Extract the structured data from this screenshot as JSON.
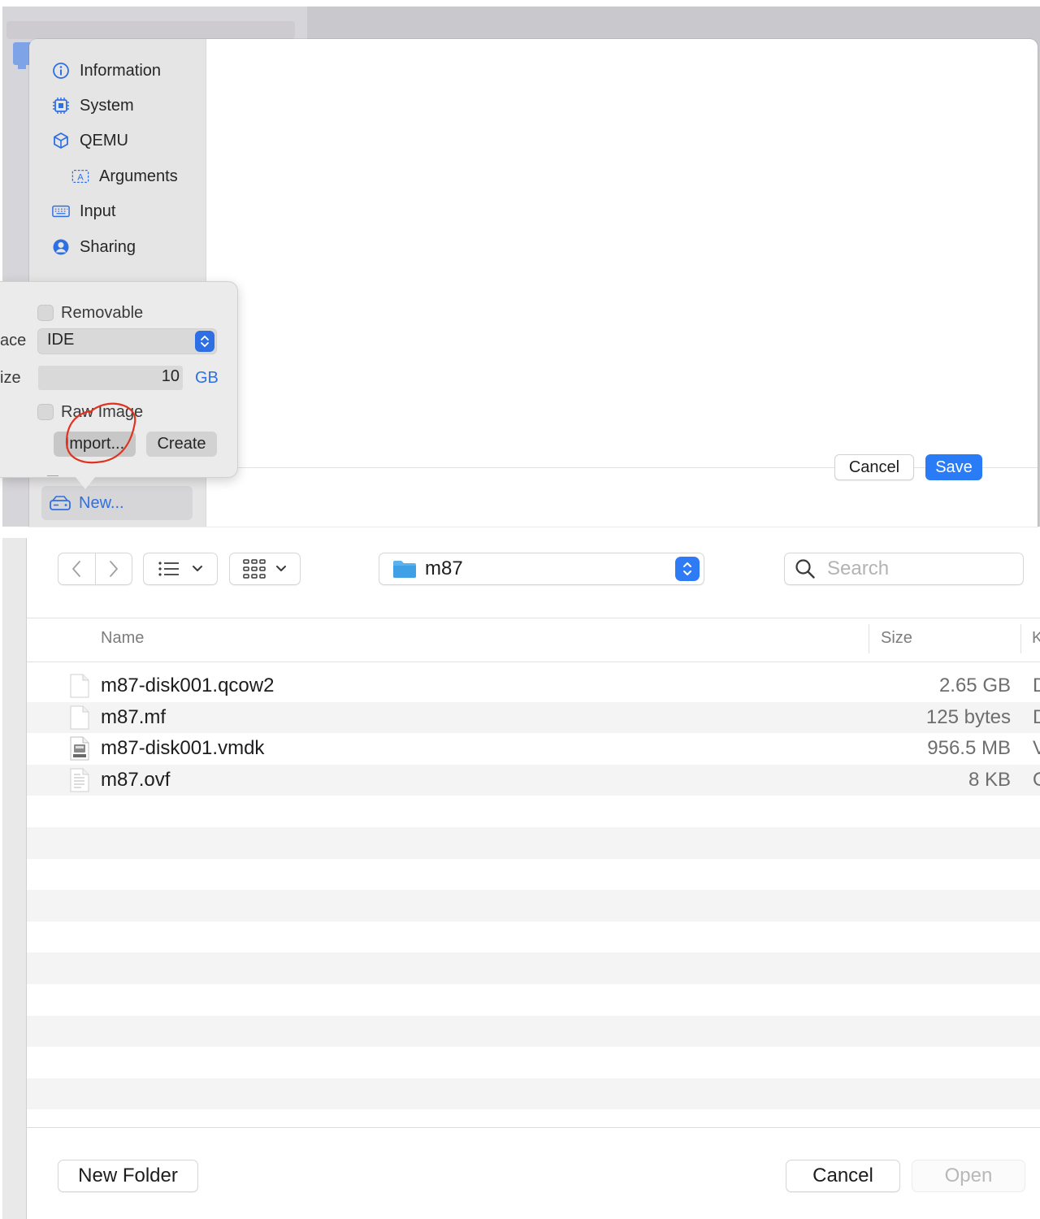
{
  "top": {
    "sidebar": {
      "items": [
        {
          "label": "Information",
          "icon": "info-circle-icon"
        },
        {
          "label": "System",
          "icon": "cpu-chip-icon"
        },
        {
          "label": "QEMU",
          "icon": "cube-icon"
        },
        {
          "label": "Arguments",
          "icon": "arguments-a-icon"
        },
        {
          "label": "Input",
          "icon": "keyboard-icon"
        },
        {
          "label": "Sharing",
          "icon": "person-circle-icon"
        }
      ],
      "new_button": "New..."
    },
    "popover": {
      "removable_label": "Removable",
      "removable_checked": false,
      "interface_label_partial": "ace",
      "interface_value": "IDE",
      "size_label_partial": "ize",
      "size_value": "10",
      "size_unit": "GB",
      "raw_image_label": "Raw Image",
      "raw_image_checked": false,
      "import_label": "Import...",
      "create_label": "Create"
    },
    "footer": {
      "cancel_label": "Cancel",
      "save_label": "Save"
    },
    "colors": {
      "accent": "#2f6fe4",
      "save_button": "#2a7bf6",
      "annotation": "#e0321f"
    }
  },
  "bottom": {
    "toolbar": {
      "back_icon": "chevron-left-icon",
      "forward_icon": "chevron-right-icon",
      "list_view_icon": "list-view-icon",
      "grid_view_icon": "icon-grid-icon",
      "path_label": "m87",
      "search_placeholder": "Search"
    },
    "columns": {
      "name": "Name",
      "size": "Size",
      "kind_partial": "K"
    },
    "files": [
      {
        "name": "m87-disk001.qcow2",
        "size": "2.65 GB",
        "kind_partial": "D",
        "icon": "blank-document-icon"
      },
      {
        "name": "m87.mf",
        "size": "125 bytes",
        "kind_partial": "D",
        "icon": "blank-document-icon"
      },
      {
        "name": "m87-disk001.vmdk",
        "size": "956.5 MB",
        "kind_partial": "V",
        "icon": "vmdk-document-icon"
      },
      {
        "name": "m87.ovf",
        "size": "8 KB",
        "kind_partial": "O",
        "icon": "text-document-icon"
      }
    ],
    "footer": {
      "new_folder_label": "New Folder",
      "cancel_label": "Cancel",
      "open_label": "Open"
    }
  }
}
